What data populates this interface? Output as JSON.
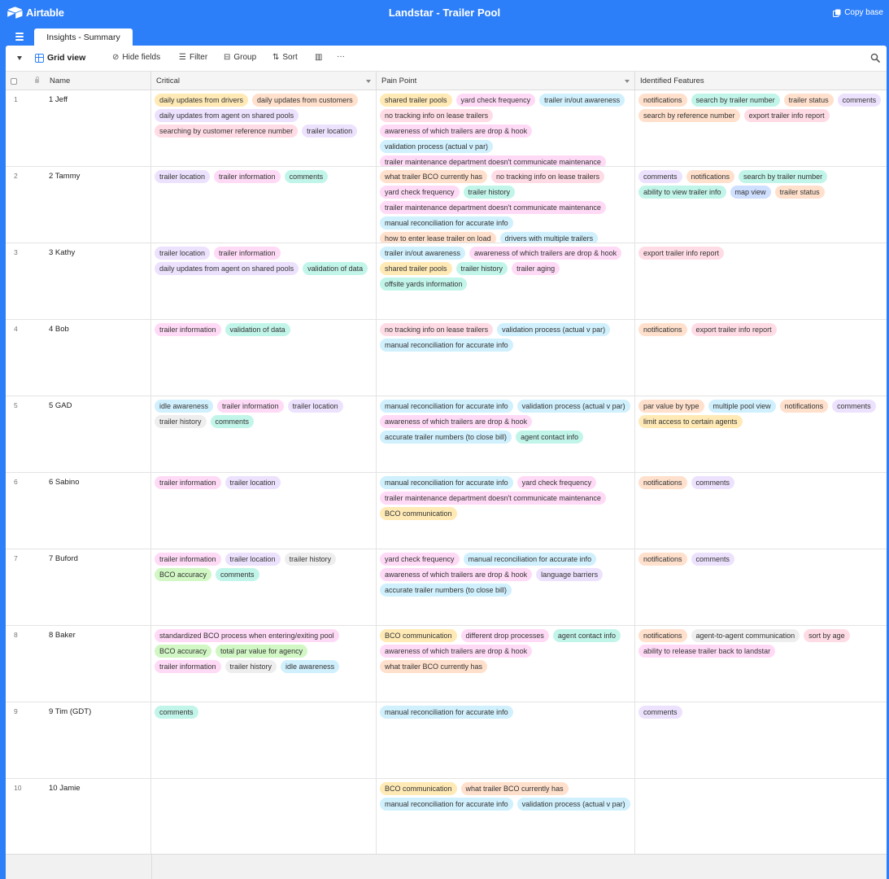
{
  "app": {
    "logo_text": "Airtable",
    "base_title": "Landstar - Trailer Pool",
    "copy_base_label": "Copy base"
  },
  "tab": {
    "label": "Insights - Summary"
  },
  "toolbar": {
    "view_name": "Grid view",
    "hide_fields_label": "Hide fields",
    "filter_label": "Filter",
    "group_label": "Group",
    "sort_label": "Sort",
    "more_label": "···"
  },
  "columns": {
    "name": "Name",
    "critical": "Critical",
    "pain_point": "Pain Point",
    "features": "Identified Features"
  },
  "colors": {
    "orange": "#ffe0cc",
    "yellow": "#ffeab6",
    "purple": "#ede2fe",
    "pink": "#ffdaf6",
    "blue": "#d0f0fd",
    "cyan": "#c2f5e9",
    "red": "#ffdce5",
    "green": "#d1f7c4",
    "gray": "#eeeeee",
    "indigo": "#cfdfff",
    "brand": "#2d7ff9"
  },
  "rows": [
    {
      "num": "1",
      "name": "1 Jeff",
      "critical": [
        {
          "label": "daily updates from drivers",
          "color": "yellow"
        },
        {
          "label": "daily updates from customers",
          "color": "orange"
        },
        {
          "label": "daily updates from agent on shared pools",
          "color": "purple"
        },
        {
          "label": "searching by customer reference number",
          "color": "red"
        },
        {
          "label": "trailer location",
          "color": "purple"
        }
      ],
      "pain": [
        {
          "label": "shared trailer pools",
          "color": "yellow"
        },
        {
          "label": "yard check frequency",
          "color": "pink"
        },
        {
          "label": "trailer in/out awareness",
          "color": "blue"
        },
        {
          "label": "no tracking info on lease trailers",
          "color": "red"
        },
        {
          "label": "awareness of which trailers are drop & hook",
          "color": "pink"
        },
        {
          "label": "validation process (actual v par)",
          "color": "blue"
        },
        {
          "label": "trailer maintenance department doesn't communicate maintenance",
          "color": "pink"
        }
      ],
      "features": [
        {
          "label": "notifications",
          "color": "orange"
        },
        {
          "label": "search by trailer number",
          "color": "cyan"
        },
        {
          "label": "trailer status",
          "color": "orange"
        },
        {
          "label": "comments",
          "color": "purple"
        },
        {
          "label": "search by reference number",
          "color": "orange"
        },
        {
          "label": "export trailer info report",
          "color": "red"
        }
      ]
    },
    {
      "num": "2",
      "name": "2 Tammy",
      "critical": [
        {
          "label": "trailer location",
          "color": "purple"
        },
        {
          "label": "trailer information",
          "color": "pink"
        },
        {
          "label": "comments",
          "color": "cyan"
        }
      ],
      "pain": [
        {
          "label": "what trailer BCO currently has",
          "color": "orange"
        },
        {
          "label": "no tracking info on lease trailers",
          "color": "red"
        },
        {
          "label": "yard check frequency",
          "color": "pink"
        },
        {
          "label": "trailer history",
          "color": "cyan"
        },
        {
          "label": "trailer maintenance department doesn't communicate maintenance",
          "color": "pink"
        },
        {
          "label": "manual reconciliation for accurate info",
          "color": "blue"
        },
        {
          "label": "how to enter lease trailer on load",
          "color": "orange"
        },
        {
          "label": "drivers with multiple trailers",
          "color": "blue"
        }
      ],
      "features": [
        {
          "label": "comments",
          "color": "purple"
        },
        {
          "label": "notifications",
          "color": "orange"
        },
        {
          "label": "search by trailer number",
          "color": "cyan"
        },
        {
          "label": "ability to view trailer info",
          "color": "cyan"
        },
        {
          "label": "map view",
          "color": "indigo"
        },
        {
          "label": "trailer status",
          "color": "orange"
        }
      ]
    },
    {
      "num": "3",
      "name": "3 Kathy",
      "critical": [
        {
          "label": "trailer location",
          "color": "purple"
        },
        {
          "label": "trailer information",
          "color": "pink"
        },
        {
          "label": "daily updates from agent on shared pools",
          "color": "purple"
        },
        {
          "label": "validation of data",
          "color": "cyan"
        }
      ],
      "pain": [
        {
          "label": "trailer in/out awareness",
          "color": "blue"
        },
        {
          "label": "awareness of which trailers are drop & hook",
          "color": "pink"
        },
        {
          "label": "shared trailer pools",
          "color": "yellow"
        },
        {
          "label": "trailer history",
          "color": "cyan"
        },
        {
          "label": "trailer aging",
          "color": "pink"
        },
        {
          "label": "offsite yards information",
          "color": "cyan"
        }
      ],
      "features": [
        {
          "label": "export trailer info report",
          "color": "red"
        }
      ]
    },
    {
      "num": "4",
      "name": "4 Bob",
      "critical": [
        {
          "label": "trailer information",
          "color": "pink"
        },
        {
          "label": "validation of data",
          "color": "cyan"
        }
      ],
      "pain": [
        {
          "label": "no tracking info on lease trailers",
          "color": "red"
        },
        {
          "label": "validation process (actual v par)",
          "color": "blue"
        },
        {
          "label": "manual reconciliation for accurate info",
          "color": "blue"
        }
      ],
      "features": [
        {
          "label": "notifications",
          "color": "orange"
        },
        {
          "label": "export trailer info report",
          "color": "red"
        }
      ]
    },
    {
      "num": "5",
      "name": "5 GAD",
      "critical": [
        {
          "label": "idle awareness",
          "color": "blue"
        },
        {
          "label": "trailer information",
          "color": "pink"
        },
        {
          "label": "trailer location",
          "color": "purple"
        },
        {
          "label": "trailer history",
          "color": "gray"
        },
        {
          "label": "comments",
          "color": "cyan"
        }
      ],
      "pain": [
        {
          "label": "manual reconciliation for accurate info",
          "color": "blue"
        },
        {
          "label": "validation process (actual v par)",
          "color": "blue"
        },
        {
          "label": "awareness of which trailers are drop & hook",
          "color": "pink"
        },
        {
          "label": "accurate trailer numbers (to close bill)",
          "color": "blue"
        },
        {
          "label": "agent contact info",
          "color": "cyan"
        }
      ],
      "features": [
        {
          "label": "par value by type",
          "color": "orange"
        },
        {
          "label": "multiple pool view",
          "color": "blue"
        },
        {
          "label": "notifications",
          "color": "orange"
        },
        {
          "label": "comments",
          "color": "purple"
        },
        {
          "label": "limit access to certain agents",
          "color": "yellow"
        }
      ]
    },
    {
      "num": "6",
      "name": "6 Sabino",
      "critical": [
        {
          "label": "trailer information",
          "color": "pink"
        },
        {
          "label": "trailer location",
          "color": "purple"
        }
      ],
      "pain": [
        {
          "label": "manual reconciliation for accurate info",
          "color": "blue"
        },
        {
          "label": "yard check frequency",
          "color": "pink"
        },
        {
          "label": "trailer maintenance department doesn't communicate maintenance",
          "color": "pink"
        },
        {
          "label": "BCO communication",
          "color": "yellow"
        }
      ],
      "features": [
        {
          "label": "notifications",
          "color": "orange"
        },
        {
          "label": "comments",
          "color": "purple"
        }
      ]
    },
    {
      "num": "7",
      "name": "7 Buford",
      "critical": [
        {
          "label": "trailer information",
          "color": "pink"
        },
        {
          "label": "trailer location",
          "color": "purple"
        },
        {
          "label": "trailer history",
          "color": "gray"
        },
        {
          "label": "BCO accuracy",
          "color": "green"
        },
        {
          "label": "comments",
          "color": "cyan"
        }
      ],
      "pain": [
        {
          "label": "yard check frequency",
          "color": "pink"
        },
        {
          "label": "manual reconciliation for accurate info",
          "color": "blue"
        },
        {
          "label": "awareness of which trailers are drop & hook",
          "color": "pink"
        },
        {
          "label": "language barriers",
          "color": "purple"
        },
        {
          "label": "accurate trailer numbers (to close bill)",
          "color": "blue"
        }
      ],
      "features": [
        {
          "label": "notifications",
          "color": "orange"
        },
        {
          "label": "comments",
          "color": "purple"
        }
      ]
    },
    {
      "num": "8",
      "name": "8 Baker",
      "critical": [
        {
          "label": "standardized BCO process when entering/exiting pool",
          "color": "pink"
        },
        {
          "label": "BCO accuracy",
          "color": "green"
        },
        {
          "label": "total par value for agency",
          "color": "green"
        },
        {
          "label": "trailer information",
          "color": "pink"
        },
        {
          "label": "trailer history",
          "color": "gray"
        },
        {
          "label": "idle awareness",
          "color": "blue"
        }
      ],
      "pain": [
        {
          "label": "BCO communication",
          "color": "yellow"
        },
        {
          "label": "different drop processes",
          "color": "pink"
        },
        {
          "label": "agent contact info",
          "color": "cyan"
        },
        {
          "label": "awareness of which trailers are drop & hook",
          "color": "pink"
        },
        {
          "label": "what trailer BCO currently has",
          "color": "orange"
        }
      ],
      "features": [
        {
          "label": "notifications",
          "color": "orange"
        },
        {
          "label": "agent-to-agent communication",
          "color": "gray"
        },
        {
          "label": "sort by age",
          "color": "red"
        },
        {
          "label": "ability to release trailer back to landstar",
          "color": "pink"
        }
      ]
    },
    {
      "num": "9",
      "name": "9 Tim (GDT)",
      "critical": [
        {
          "label": "comments",
          "color": "cyan"
        }
      ],
      "pain": [
        {
          "label": "manual reconciliation for accurate info",
          "color": "blue"
        }
      ],
      "features": [
        {
          "label": "comments",
          "color": "purple"
        }
      ]
    },
    {
      "num": "10",
      "name": "10 Jamie",
      "critical": [],
      "pain": [
        {
          "label": "BCO communication",
          "color": "yellow"
        },
        {
          "label": "what trailer BCO currently has",
          "color": "orange"
        },
        {
          "label": "manual reconciliation for accurate info",
          "color": "blue"
        },
        {
          "label": "validation process (actual v par)",
          "color": "blue"
        }
      ],
      "features": []
    }
  ]
}
